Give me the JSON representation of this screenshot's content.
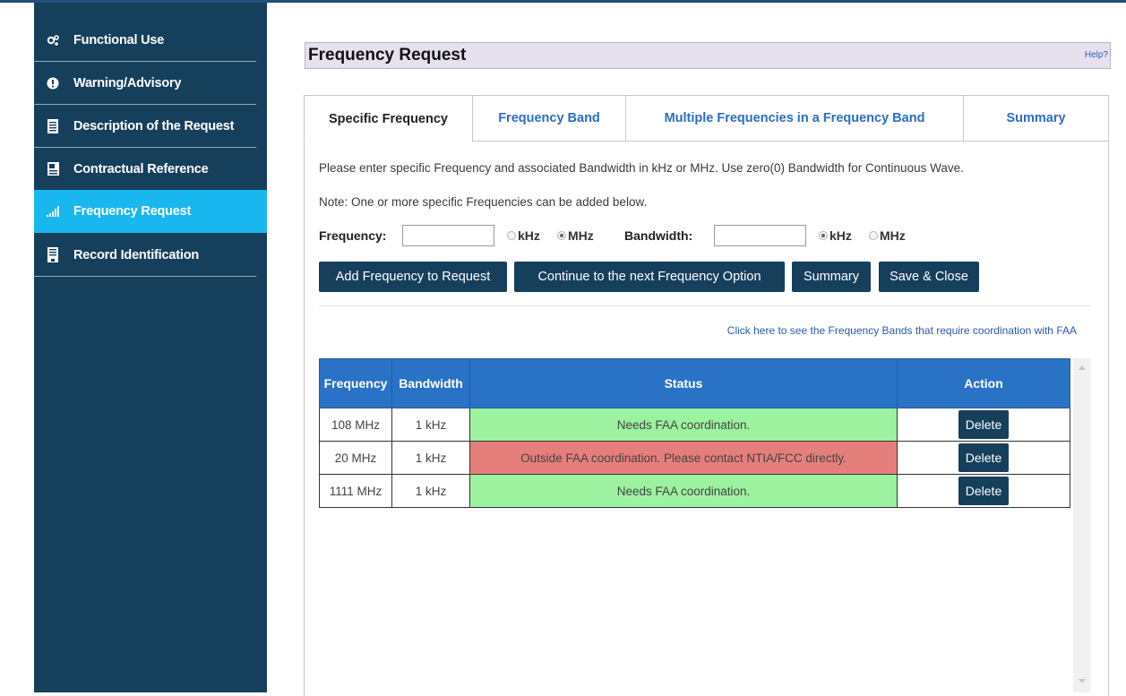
{
  "sidebar": {
    "items": [
      {
        "label": "Functional Use",
        "icon": "gears-icon"
      },
      {
        "label": "Warning/Advisory",
        "icon": "alert-icon"
      },
      {
        "label": "Description of the Request",
        "icon": "document-icon"
      },
      {
        "label": "Contractual Reference",
        "icon": "contract-icon"
      },
      {
        "label": "Frequency Request",
        "icon": "signal-bars-icon",
        "active": true
      },
      {
        "label": "Record Identification",
        "icon": "id-card-icon"
      }
    ]
  },
  "header": {
    "title": "Frequency Request",
    "help": "Help?"
  },
  "tabs": [
    {
      "label": "Specific Frequency",
      "active": true
    },
    {
      "label": "Frequency Band"
    },
    {
      "label": "Multiple Frequencies in a Frequency Band"
    },
    {
      "label": "Summary"
    }
  ],
  "instructions": {
    "line1": "Please enter specific Frequency and associated Bandwidth in kHz or MHz. Use zero(0) Bandwidth for Continuous Wave.",
    "line2": "Note: One or more specific Frequencies can be added below."
  },
  "form": {
    "frequency_label": "Frequency:",
    "frequency_value": "",
    "frequency_units": [
      "kHz",
      "MHz"
    ],
    "frequency_unit_selected": "MHz",
    "bandwidth_label": "Bandwidth:",
    "bandwidth_value": "",
    "bandwidth_units": [
      "kHz",
      "MHz"
    ],
    "bandwidth_unit_selected": "kHz"
  },
  "buttons": {
    "add": "Add Frequency to Request",
    "continue": "Continue to the next Frequency Option",
    "summary": "Summary",
    "save_close": "Save & Close"
  },
  "faa_link": "Click here to see the Frequency Bands that require coordination with FAA",
  "table": {
    "headers": [
      "Frequency",
      "Bandwidth",
      "Status",
      "Action"
    ],
    "rows": [
      {
        "frequency": "108 MHz",
        "bandwidth": "1 kHz",
        "status": "Needs FAA coordination.",
        "status_color": "#9cf29e",
        "action": "Delete"
      },
      {
        "frequency": "20 MHz",
        "bandwidth": "1 kHz",
        "status": "Outside FAA coordination. Please contact NTIA/FCC directly.",
        "status_color": "#e57f7c",
        "action": "Delete"
      },
      {
        "frequency": "1111 MHz",
        "bandwidth": "1 kHz",
        "status": "Needs FAA coordination.",
        "status_color": "#9cf29e",
        "action": "Delete"
      }
    ]
  },
  "colors": {
    "sidebar_bg": "#163f5c",
    "active_item": "#19b7ef",
    "table_header": "#2a72c6",
    "button_bg": "#163f5c"
  }
}
